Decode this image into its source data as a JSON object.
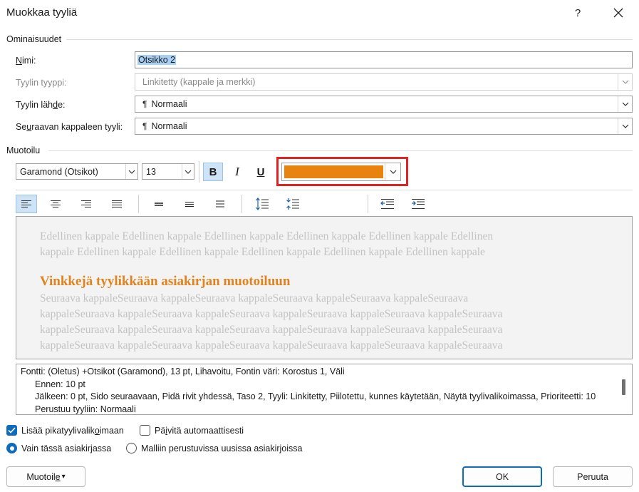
{
  "window": {
    "title": "Muokkaa tyyliä",
    "help": "?",
    "close": "✕"
  },
  "properties": {
    "section_label": "Ominaisuudet",
    "name_label_u": "N",
    "name_label_rest": "imi:",
    "name_value": "Otsikko 2",
    "type_label": "Tyylin tyyppi:",
    "type_value": "Linkitetty (kappale ja merkki)",
    "base_label_pre": "Tyylin läh",
    "base_label_u": "d",
    "base_label_post": "e:",
    "base_value": "Normaali",
    "next_label_pre": "Se",
    "next_label_u": "u",
    "next_label_post": "raavan kappaleen tyyli:",
    "next_value": "Normaali",
    "pilcrow": "¶"
  },
  "formatting": {
    "section_label": "Muotoilu",
    "font": "Garamond (Otsikot)",
    "size": "13",
    "bold": "B",
    "italic": "I",
    "underline": "U",
    "font_color": "#e8830f"
  },
  "preview": {
    "previous_lines": [
      "Edellinen kappale Edellinen kappale Edellinen kappale Edellinen kappale Edellinen kappale Edellinen",
      "kappale Edellinen kappale Edellinen kappale Edellinen kappale Edellinen kappale Edellinen kappale"
    ],
    "heading": "Vinkkejä tyylikkään asiakirjan muotoiluun",
    "following_lines": [
      "Seuraava kappaleSeuraava kappaleSeuraava kappaleSeuraava kappaleSeuraava kappaleSeuraava",
      "kappaleSeuraava kappaleSeuraava kappaleSeuraava kappaleSeuraava kappaleSeuraava kappaleSeuraava",
      "kappaleSeuraava kappaleSeuraava kappaleSeuraava kappaleSeuraava kappaleSeuraava kappaleSeuraava",
      "kappaleSeuraava kappaleSeuraava kappaleSeuraava kappaleSeuraava kappaleSeuraava kappaleSeuraava"
    ]
  },
  "description": {
    "line1": "Fontti: (Oletus) +Otsikot (Garamond), 13 pt, Lihavoitu, Fontin väri: Korostus 1, Väli",
    "line2": "Ennen:  10 pt",
    "line3": "Jälkeen:  0 pt, Sido seuraavaan, Pidä rivit yhdessä, Taso 2, Tyyli: Linkitetty, Piilotettu, kunnes käytetään, Näytä tyylivalikoimassa, Prioriteetti: 10",
    "line4": "Perustuu tyyliin: Normaali"
  },
  "options": {
    "add_gallery_pre": "Lisää pikatyylivalik",
    "add_gallery_u": "o",
    "add_gallery_post": "imaan",
    "add_gallery_checked": true,
    "auto_update_pre": "Pä",
    "auto_update_u": "i",
    "auto_update_post": "vitä automaattisesti",
    "auto_update_checked": false,
    "only_doc_pre": "Vain tässä asiakir",
    "only_doc_u": "j",
    "only_doc_post": "assa",
    "new_docs": "Malliin perustuvissa uusissa asiakirjoissa"
  },
  "buttons": {
    "format_pre": "Muotoil",
    "format_u": "e",
    "format_arrow": "▾",
    "ok": "OK",
    "cancel": "Peruuta"
  }
}
